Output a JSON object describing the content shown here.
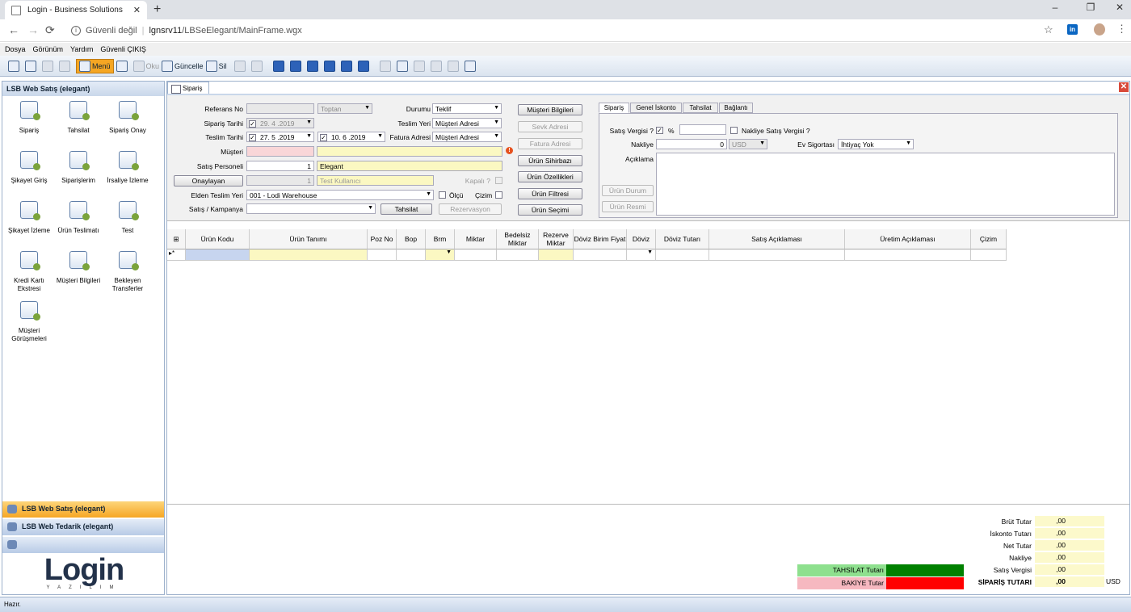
{
  "browser": {
    "tab_title": "Login - Business Solutions",
    "new_tab": "+",
    "security": "Güvenli değil",
    "url_host": "lgnsrv11",
    "url_path": "/LBSeElegant/MainFrame.wgx",
    "win_min": "–",
    "win_max": "❐",
    "win_close": "✕",
    "back": "←",
    "forward": "→",
    "reload": "⟳"
  },
  "menubar": [
    "Dosya",
    "Görünüm",
    "Yardım",
    "Güvenli ÇIKIŞ"
  ],
  "toolbar": {
    "menu": "Menü",
    "oku": "Oku",
    "guncelle": "Güncelle",
    "sil": "Sil"
  },
  "left": {
    "header": "LSB Web Satış (elegant)",
    "modules": [
      {
        "label": "Sipariş"
      },
      {
        "label": "Tahsilat"
      },
      {
        "label": "Sipariş Onay"
      },
      {
        "label": "Şikayet Giriş"
      },
      {
        "label": "Siparişlerim"
      },
      {
        "label": "İrsaliye İzleme"
      },
      {
        "label": "Şikayet İzleme"
      },
      {
        "label": "Ürün Teslimatı"
      },
      {
        "label": "Test"
      },
      {
        "label": "Kredi Kartı Ekstresi"
      },
      {
        "label": "Müşteri Bilgileri"
      },
      {
        "label": "Bekleyen Transferler"
      },
      {
        "label": "Müşteri Görüşmeleri"
      }
    ],
    "groups": [
      "LSB Web Satış (elegant)",
      "LSB Web Tedarik (elegant)"
    ],
    "logo": "Login",
    "logo_sub": "YAZILIM"
  },
  "main_tab": "Sipariş",
  "form": {
    "ref_no_label": "Referans No",
    "ref_no": "",
    "ref_type": "Toptan",
    "order_date_label": "Sipariş Tarihi",
    "order_date": "29. 4 .2019",
    "delivery_date_label": "Teslim Tarihi",
    "delivery_date1": "27. 5 .2019",
    "delivery_date2": "10. 6 .2019",
    "customer_label": "Müşteri",
    "salesperson_label": "Satış Personeli",
    "salesperson_code": "1",
    "salesperson_name": "Elegant",
    "approver_button": "Onaylayan",
    "approver_code": "1",
    "approver_name": "Test Kullanıcı",
    "closed_label": "Kapalı ?",
    "handover_label": "Elden Teslim Yeri",
    "handover": "001 - Lodi Warehouse",
    "olcu_label": "Ölçü",
    "cizim_label": "Çizim",
    "campaign_label": "Satış / Kampanya",
    "tahsilat_button": "Tahsilat",
    "reservation_button": "Rezervasyon",
    "status_label": "Durumu",
    "status": "Teklif",
    "delivery_place_label": "Teslim Yeri",
    "delivery_place": "Müşteri Adresi",
    "invoice_address_label": "Fatura Adresi",
    "invoice_address": "Müşteri Adresi"
  },
  "side_buttons": [
    "Müşteri Bilgileri",
    "Sevk Adresi",
    "Fatura Adresi",
    "Ürün Sihirbazı",
    "Ürün Özellikleri",
    "Ürün Filtresi",
    "Ürün Seçimi"
  ],
  "right_panel": {
    "tabs": [
      "Sipariş",
      "Genel İskonto",
      "Tahsilat",
      "Bağlantı"
    ],
    "vat_label": "Satış Vergisi ?",
    "percent": "%",
    "freight_vat_label": "Nakliye Satış Vergisi ?",
    "freight_label": "Nakliye",
    "freight_value": "0",
    "currency": "USD",
    "insurance_label": "Ev Sigortası",
    "insurance": "İhtiyaç Yok",
    "note_label": "Açıklama",
    "product_status": "Ürün Durum",
    "product_image": "Ürün Resmi"
  },
  "grid": {
    "columns": [
      "Ürün Kodu",
      "Ürün Tanımı",
      "Poz No",
      "Bop",
      "Brm",
      "Miktar",
      "Bedelsiz Miktar",
      "Rezerve Miktar",
      "Döviz Birim Fiyat",
      "Döviz",
      "Döviz Tutarı",
      "Satış Açıklaması",
      "Üretim Açıklaması",
      "Çizim"
    ],
    "new_row_marker": "▸*"
  },
  "totals": {
    "labels": [
      "Brüt Tutar",
      "İskonto Tutarı",
      "Net Tutar",
      "Nakliye",
      "Satış Vergisi",
      "SİPARİŞ TUTARI"
    ],
    "values": [
      ",00",
      ",00",
      ",00",
      ",00",
      ",00",
      ",00"
    ],
    "currency": "USD",
    "collection_label": "TAHSİLAT Tutarı",
    "balance_label": "BAKİYE Tutar",
    "collection_color": "#008000",
    "balance_color": "#ff0000"
  },
  "status_bar": "Hazır."
}
